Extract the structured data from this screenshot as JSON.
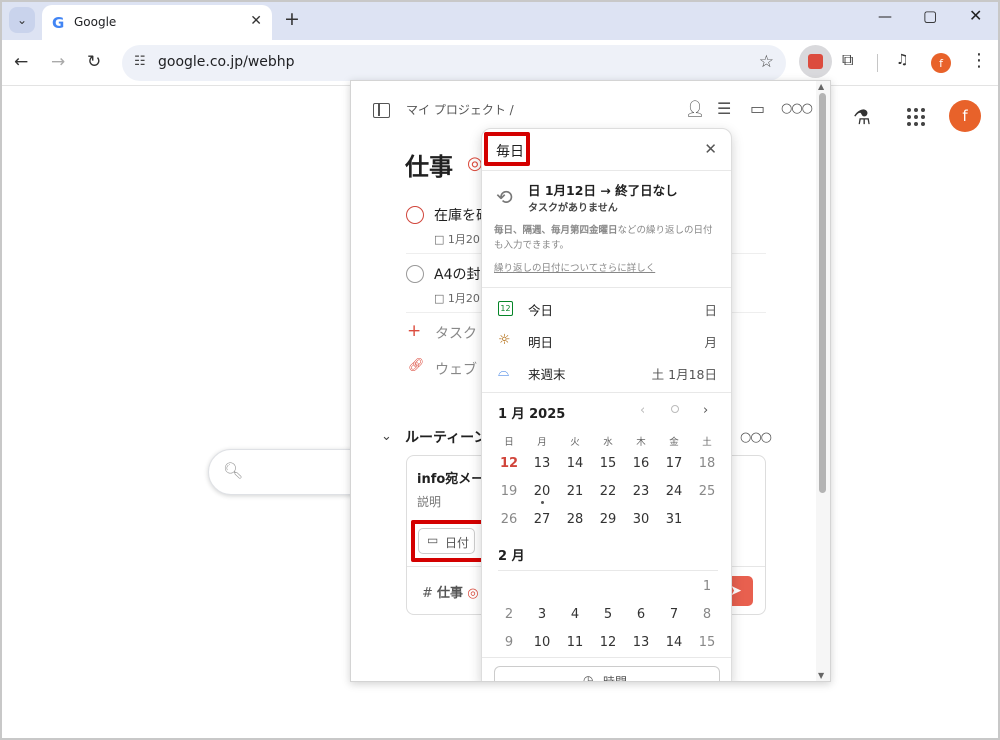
{
  "browser": {
    "tab_title": "Google",
    "url": "google.co.jp/webhp",
    "profile_initial": "f"
  },
  "google": {
    "profile_initial": "f"
  },
  "todoist": {
    "breadcrumb": "マイ プロジェクト /",
    "project_title": "仕事",
    "tasks": [
      {
        "name": "在庫を確",
        "date": "1月20"
      },
      {
        "name": "A4の封",
        "date": "1月20"
      }
    ],
    "add_task_label": "タスク",
    "web_label": "ウェブ",
    "section_name": "ルーティーン",
    "editor": {
      "task_title": "info宛メー",
      "description": "説明",
      "date_button": "日付",
      "project_label": "仕事"
    },
    "datepicker": {
      "input_value": "毎日",
      "recurrence_title": "日 1月12日 → 終了日なし",
      "recurrence_subtitle": "タスクがありません",
      "help_bold": "毎日、隔週、毎月第四金曜日",
      "help_text": "などの繰り返しの日付も入力できます。",
      "learn_more": "繰り返しの日付についてさらに詳しく",
      "quick": [
        {
          "label": "今日",
          "right": "日",
          "icon": "calendar-today-icon"
        },
        {
          "label": "明日",
          "right": "月",
          "icon": "sun-icon"
        },
        {
          "label": "来週末",
          "right": "土 1月18日",
          "icon": "sofa-icon"
        }
      ],
      "month1": "1 月 2025",
      "month2": "2 月",
      "weekdays": [
        "日",
        "月",
        "火",
        "水",
        "木",
        "金",
        "土"
      ],
      "jan_rows": [
        [
          "12",
          "13",
          "14",
          "15",
          "16",
          "17",
          "18"
        ],
        [
          "19",
          "20",
          "21",
          "22",
          "23",
          "24",
          "25"
        ],
        [
          "26",
          "27",
          "28",
          "29",
          "30",
          "31",
          ""
        ]
      ],
      "feb_rows": [
        [
          "",
          "",
          "",
          "",
          "",
          "",
          "1"
        ],
        [
          "2",
          "3",
          "4",
          "5",
          "6",
          "7",
          "8"
        ],
        [
          "9",
          "10",
          "11",
          "12",
          "13",
          "14",
          "15"
        ]
      ],
      "time_label": "時間"
    }
  }
}
